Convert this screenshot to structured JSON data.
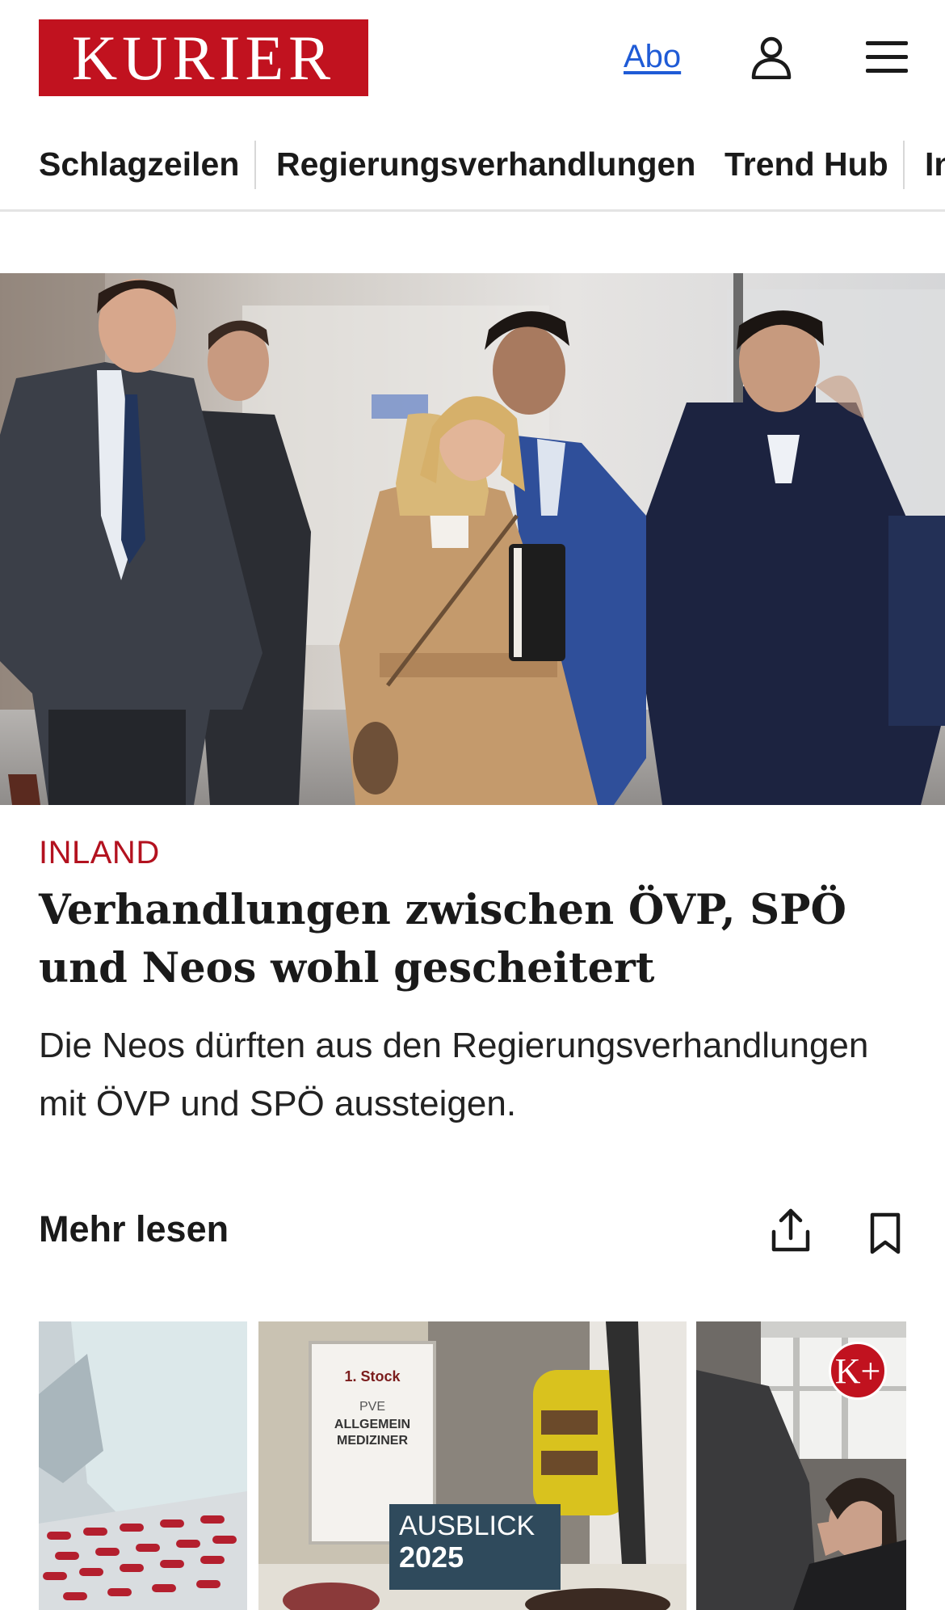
{
  "header": {
    "logo_text": "KURIER",
    "abo_label": "Abo",
    "user_icon": "user-icon",
    "menu_icon": "hamburger-menu-icon"
  },
  "nav": {
    "items": [
      {
        "label": "Schlagzeilen"
      },
      {
        "label": "Regierungsverhandlungen"
      },
      {
        "label": "Trend Hub"
      },
      {
        "label": "In"
      }
    ]
  },
  "article": {
    "category": "INLAND",
    "headline": "Verhandlungen zwischen ÖVP, SPÖ und Neos wohl gescheitert",
    "teaser": "Die Neos dürften aus den Regierungsverhandlungen mit ÖVP und SPÖ aussteigen.",
    "more_label": "Mehr lesen",
    "share_icon": "share-icon",
    "bookmark_icon": "bookmark-icon"
  },
  "thumbnails": {
    "middle_sign_line1": "1. Stock",
    "middle_sign_line2": "PVE",
    "middle_sign_line3": "ALLGEMEIN",
    "middle_sign_line4": "MEDIZINER",
    "middle_banner_line1": "AUSBLICK",
    "middle_banner_line2": "2025",
    "kplus_badge": "K+"
  },
  "colors": {
    "brand_red": "#c1121f",
    "category_red": "#b3121f",
    "link_blue": "#1f5bd6"
  }
}
